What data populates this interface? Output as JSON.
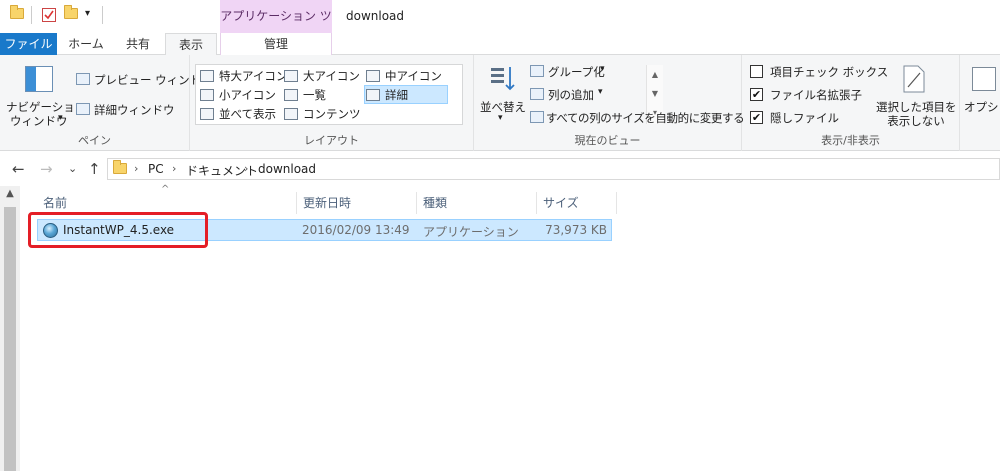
{
  "window": {
    "title": "download",
    "context_tab_group": "アプリケーション ツール"
  },
  "tabs": [
    {
      "label": "ファイル"
    },
    {
      "label": "ホーム"
    },
    {
      "label": "共有"
    },
    {
      "label": "表示"
    },
    {
      "label": "管理"
    }
  ],
  "ribbon": {
    "pane": {
      "label": "ペイン",
      "nav_pane_line1": "ナビゲーション",
      "nav_pane_line2": "ウィンドウ",
      "nav_pane_arrow": "▾",
      "preview": "プレビュー ウィンドウ",
      "details": "詳細ウィンドウ"
    },
    "layout": {
      "label": "レイアウト",
      "items": [
        "特大アイコン",
        "大アイコン",
        "中アイコン",
        "小アイコン",
        "一覧",
        "詳細",
        "並べて表示",
        "コンテンツ"
      ],
      "scroll_up": "▲",
      "scroll_down": "▼",
      "scroll_more": "▾"
    },
    "current_view": {
      "label": "現在のビュー",
      "sort_line1": "並べ替え",
      "sort_arrow": "▾",
      "group_by": "グループ化",
      "add_column": "列の追加",
      "fit_columns": "すべての列のサイズを自動的に変更する",
      "dropdown": "▾"
    },
    "show_hide": {
      "label": "表示/非表示",
      "item_checkboxes": "項目チェック ボックス",
      "item_checkboxes_checked": false,
      "file_extensions": "ファイル名拡張子",
      "file_extensions_checked": true,
      "hidden_items": "隠しファイル",
      "hidden_items_checked": true,
      "hide_selected_line1": "選択した項目を",
      "hide_selected_line2": "表示しない",
      "check_mark": "✔"
    },
    "options": {
      "label": "オプショ"
    }
  },
  "nav": {
    "back": "←",
    "forward": "→",
    "recent": "⌄",
    "up": "↑"
  },
  "address": {
    "separator": "›",
    "crumbs": [
      "PC",
      "ドキュメント",
      "download"
    ]
  },
  "file_list": {
    "sort_indicator": "^",
    "columns": [
      "名前",
      "更新日時",
      "種類",
      "サイズ"
    ],
    "rows": [
      {
        "name": "InstantWP_4.5.exe",
        "modified": "2016/02/09 13:49",
        "type": "アプリケーション",
        "size": "73,973 KB",
        "selected": true
      }
    ]
  },
  "scrollbar": {
    "up": "▲"
  },
  "colors": {
    "file_tab": "#1979ca",
    "context_tab": "#f0d5f5",
    "selection": "#cce8ff",
    "annotation": "#e41e26"
  }
}
